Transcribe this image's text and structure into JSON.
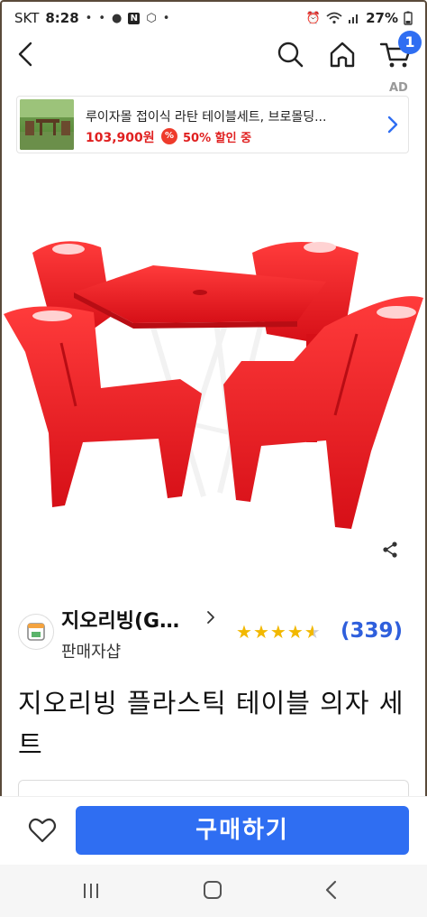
{
  "status_bar": {
    "carrier": "SKT",
    "time": "8:28",
    "battery": "27%",
    "notification_icons": [
      "drop-icon",
      "drop-icon",
      "chat-icon",
      "naver-icon",
      "cube-icon",
      "dot-icon"
    ],
    "system_icons": [
      "alarm-icon",
      "wifi-icon",
      "signal-icon"
    ]
  },
  "header": {
    "back_icon": "back-icon",
    "search_icon": "search-icon",
    "home_icon": "home-icon",
    "cart_icon": "cart-icon",
    "cart_count": "1"
  },
  "ad": {
    "label": "AD",
    "title": "루이자몰 접이식 라탄 테이블세트, 브로몰딩...",
    "price": "103,900원",
    "discount_icon": "%",
    "discount_text": "50% 할인 중"
  },
  "product": {
    "image_description": "red plastic table and four chairs"
  },
  "seller": {
    "name": "지오리빙(G…",
    "type": "판매자샵",
    "rating": 4.5,
    "review_count": "(339)"
  },
  "title": "지오리빙 플라스틱 테이블 의자 세트",
  "buy_bar": {
    "buy_label": "구매하기"
  },
  "colors": {
    "accent_blue": "#2f6ef2",
    "price_red": "#e02020",
    "star_gold": "#f2b800",
    "product_red": "#e8141d"
  }
}
